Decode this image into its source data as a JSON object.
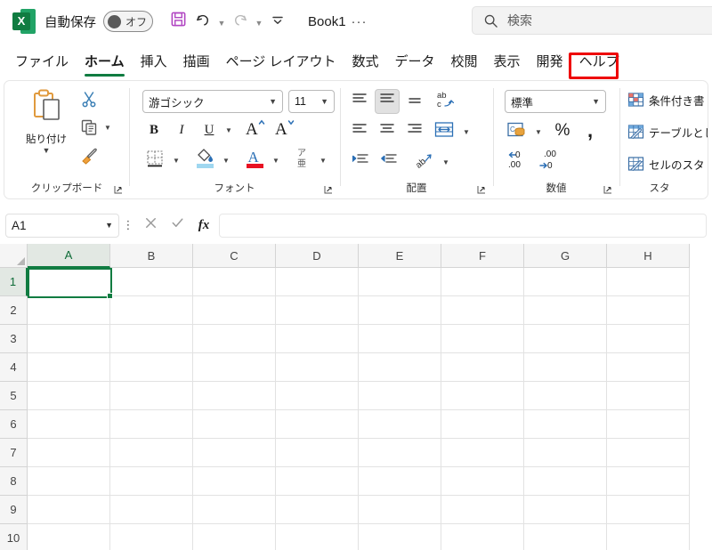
{
  "titlebar": {
    "app_icon": "excel-logo-icon",
    "autosave_label": "自動保存",
    "autosave_state": "オフ",
    "save_icon": "save-icon",
    "undo_icon": "undo-icon",
    "redo_icon": "redo-icon",
    "qat_more_icon": "customize-quick-access-toolbar-icon",
    "document_title": "Book1",
    "document_dots": "···",
    "search_icon": "search-icon",
    "search_placeholder": "検索"
  },
  "tabs": [
    {
      "label": "ファイル",
      "active": false
    },
    {
      "label": "ホーム",
      "active": true
    },
    {
      "label": "挿入",
      "active": false
    },
    {
      "label": "描画",
      "active": false
    },
    {
      "label": "ページ レイアウト",
      "active": false
    },
    {
      "label": "数式",
      "active": false
    },
    {
      "label": "データ",
      "active": false
    },
    {
      "label": "校閲",
      "active": false
    },
    {
      "label": "表示",
      "active": false
    },
    {
      "label": "開発",
      "active": false,
      "highlighted": true
    },
    {
      "label": "ヘルプ",
      "active": false
    }
  ],
  "highlight_color": "#ee0000",
  "accent_color": "#107c41",
  "ribbon": {
    "groups": [
      {
        "name": "clipboard",
        "label": "クリップボード",
        "paste_label": "貼り付け",
        "items": [
          "paste-icon",
          "cut-icon",
          "copy-icon",
          "format-painter-icon"
        ],
        "launcher": "dialog-launcher-icon"
      },
      {
        "name": "font",
        "label": "フォント",
        "font_family_value": "游ゴシック",
        "font_size_value": "11",
        "bold_label": "B",
        "italic_label": "I",
        "underline_label": "U",
        "grow_font_label": "A",
        "shrink_font_label": "A",
        "phonetic_label": "ア\n亜",
        "items": [
          "bold-icon",
          "italic-icon",
          "underline-icon",
          "increase-font-size-icon",
          "decrease-font-size-icon",
          "borders-icon",
          "fill-color-icon",
          "font-color-icon",
          "phonetic-guide-icon"
        ],
        "launcher": "dialog-launcher-icon"
      },
      {
        "name": "alignment",
        "label": "配置",
        "items": [
          "align-top-icon",
          "align-middle-icon",
          "align-bottom-icon",
          "wrap-text-icon",
          "align-left-icon",
          "align-center-icon",
          "align-right-icon",
          "merge-cells-icon",
          "decrease-indent-icon",
          "increase-indent-icon",
          "text-orientation-icon"
        ],
        "launcher": "dialog-launcher-icon"
      },
      {
        "name": "number",
        "label": "数値",
        "number_format_value": "標準",
        "percent_label": "%",
        "comma_label": "，",
        "items": [
          "accounting-format-icon",
          "percent-style-icon",
          "comma-style-icon",
          "decrease-decimal-icon",
          "increase-decimal-icon"
        ],
        "launcher": "dialog-launcher-icon"
      },
      {
        "name": "styles",
        "label": "スタ",
        "items": [
          {
            "icon": "conditional-formatting-icon",
            "label": "条件付き書"
          },
          {
            "icon": "format-as-table-icon",
            "label": "テーブルとし"
          },
          {
            "icon": "cell-styles-icon",
            "label": "セルのスタ"
          }
        ]
      }
    ]
  },
  "formula_bar": {
    "name_box_value": "A1",
    "name_box_caret": "chevron-down-icon",
    "more_icon": "vertical-ellipsis-icon",
    "cancel_icon": "cancel-icon",
    "enter_icon": "enter-icon",
    "function_icon": "insert-function-icon",
    "function_label": "fx",
    "formula_value": "",
    "formula_placeholder": ""
  },
  "grid": {
    "columns": [
      "A",
      "B",
      "C",
      "D",
      "E",
      "F",
      "G",
      "H"
    ],
    "rows": [
      "1",
      "2",
      "3",
      "4",
      "5",
      "6",
      "7",
      "8",
      "9",
      "10"
    ],
    "selected_cell": "A1",
    "selected_column": "A",
    "selected_row": "1",
    "cell_values": []
  }
}
